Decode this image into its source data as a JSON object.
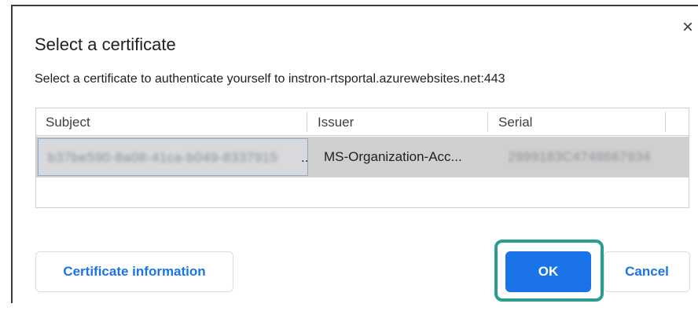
{
  "dialog": {
    "title": "Select a certificate",
    "subtitle": "Select a certificate to authenticate yourself to instron-rtsportal.azurewebsites.net:443",
    "close_symbol": "×"
  },
  "table": {
    "columns": [
      "Subject",
      "Issuer",
      "Serial"
    ],
    "rows": [
      {
        "subject": "b37be590-8a08-41ca-b049-8337915",
        "subject_suffix": "..",
        "issuer": "MS-Organization-Acc...",
        "serial": "2999183C4748667934"
      }
    ]
  },
  "buttons": {
    "certificate_info": "Certificate information",
    "ok": "OK",
    "cancel": "Cancel"
  },
  "colors": {
    "accent": "#1a73e8",
    "highlight": "#2a9d8f",
    "row_selected": "#cfcfcf"
  },
  "icons": {
    "close": "close-icon"
  }
}
